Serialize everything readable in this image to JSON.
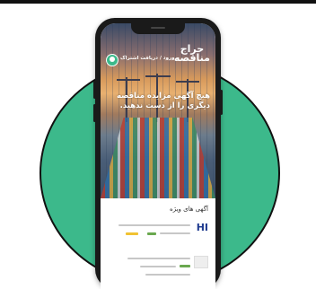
{
  "app": {
    "logo_line1": "حراج",
    "logo_line2": "مناقصه",
    "login_label": "ورود / دریافت اشتراک",
    "hero_headline": "هیچ آگهی مزایده مناقصه دیگری را از دست ندهید.",
    "featured_section_title": "آگهی های ویژه",
    "card_logo": "HI"
  },
  "colors": {
    "accent": "#3cb98b",
    "phone": "#1a1a1a"
  }
}
